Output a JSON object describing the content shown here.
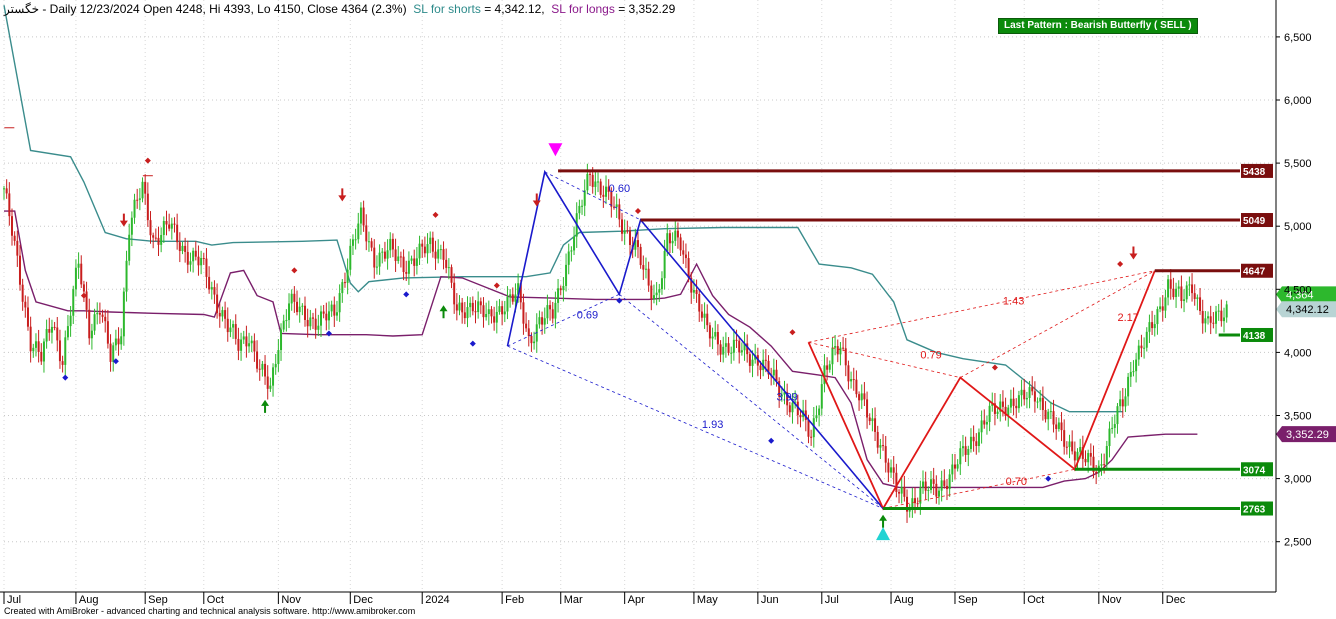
{
  "header": {
    "symbol": "خگستر",
    "info": " - Daily 12/23/2024 Open 4248, Hi 4393, Lo 4150, Close 4364 (2.3%)",
    "sl_shorts_label": "SL for shorts",
    "sl_shorts_value": "= 4,342.12,",
    "sl_longs_label": "SL for longs",
    "sl_longs_value": "= 3,352.29"
  },
  "pattern_badge": "Last Pattern : Bearish Butterfly ( SELL )",
  "credit": "Created with AmiBroker - advanced charting and technical analysis software. http://www.amibroker.com",
  "colors": {
    "background": "#ffffff",
    "up_candle": "#2db82d",
    "down_candle": "#c81e1e",
    "trail_shorts": "#3a8c8c",
    "trail_longs": "#7a1f6b",
    "red_pattern": "#e01818",
    "blue_pattern": "#1a1acc",
    "support": "#0b8a0b",
    "resistance": "#7a0e0e"
  },
  "chart_data": {
    "type": "candlestick",
    "y_axis_ticks": [
      "6,500",
      "6,000",
      "5,500",
      "5,000",
      "4,500",
      "4,000",
      "3,500",
      "3,000",
      "2,500"
    ],
    "y_axis_values": [
      6500,
      6000,
      5500,
      5000,
      4500,
      4000,
      3500,
      3000,
      2500
    ],
    "ylim": [
      2200,
      6900
    ],
    "x_axis_labels": [
      {
        "label": "Jul",
        "x": 0
      },
      {
        "label": "Aug",
        "x": 27
      },
      {
        "label": "Sep",
        "x": 53
      },
      {
        "label": "Oct",
        "x": 75
      },
      {
        "label": "Nov",
        "x": 103
      },
      {
        "label": "Dec",
        "x": 130
      },
      {
        "label": "2024",
        "x": 157
      },
      {
        "label": "Feb",
        "x": 187
      },
      {
        "label": "Mar",
        "x": 209
      },
      {
        "label": "Apr",
        "x": 233
      },
      {
        "label": "May",
        "x": 259
      },
      {
        "label": "Jun",
        "x": 283
      },
      {
        "label": "Jul",
        "x": 307
      },
      {
        "label": "Aug",
        "x": 333
      },
      {
        "label": "Sep",
        "x": 357
      },
      {
        "label": "Oct",
        "x": 383
      },
      {
        "label": "Nov",
        "x": 411
      },
      {
        "label": "Dec",
        "x": 435
      }
    ],
    "xlim": [
      0,
      464
    ],
    "price_path": [
      [
        0,
        5300
      ],
      [
        5,
        4700
      ],
      [
        10,
        4100
      ],
      [
        14,
        3950
      ],
      [
        18,
        4250
      ],
      [
        22,
        3950
      ],
      [
        28,
        4700
      ],
      [
        32,
        4200
      ],
      [
        36,
        4350
      ],
      [
        40,
        3950
      ],
      [
        44,
        4200
      ],
      [
        47,
        5000
      ],
      [
        52,
        5300
      ],
      [
        56,
        4900
      ],
      [
        62,
        5000
      ],
      [
        68,
        4800
      ],
      [
        74,
        4700
      ],
      [
        79,
        4450
      ],
      [
        84,
        4200
      ],
      [
        88,
        4050
      ],
      [
        92,
        4150
      ],
      [
        96,
        3850
      ],
      [
        100,
        3700
      ],
      [
        103,
        4100
      ],
      [
        107,
        4400
      ],
      [
        112,
        4300
      ],
      [
        118,
        4250
      ],
      [
        124,
        4300
      ],
      [
        130,
        4800
      ],
      [
        134,
        5050
      ],
      [
        139,
        4750
      ],
      [
        145,
        4800
      ],
      [
        150,
        4700
      ],
      [
        155,
        4750
      ],
      [
        160,
        4850
      ],
      [
        165,
        4800
      ],
      [
        170,
        4300
      ],
      [
        176,
        4400
      ],
      [
        182,
        4250
      ],
      [
        188,
        4400
      ],
      [
        193,
        4450
      ],
      [
        197,
        4100
      ],
      [
        201,
        4250
      ],
      [
        206,
        4300
      ],
      [
        211,
        4700
      ],
      [
        216,
        5100
      ],
      [
        220,
        5430
      ],
      [
        226,
        5250
      ],
      [
        231,
        5050
      ],
      [
        237,
        4850
      ],
      [
        242,
        4500
      ],
      [
        245,
        4450
      ],
      [
        249,
        4900
      ],
      [
        254,
        4850
      ],
      [
        259,
        4500
      ],
      [
        264,
        4150
      ],
      [
        271,
        4050
      ],
      [
        278,
        4000
      ],
      [
        283,
        3950
      ],
      [
        290,
        3750
      ],
      [
        297,
        3550
      ],
      [
        303,
        3350
      ],
      [
        308,
        3850
      ],
      [
        314,
        4050
      ],
      [
        319,
        3750
      ],
      [
        324,
        3500
      ],
      [
        329,
        3300
      ],
      [
        335,
        2900
      ],
      [
        340,
        2800
      ],
      [
        344,
        2900
      ],
      [
        350,
        2920
      ],
      [
        356,
        3050
      ],
      [
        363,
        3300
      ],
      [
        370,
        3500
      ],
      [
        376,
        3600
      ],
      [
        381,
        3600
      ],
      [
        387,
        3700
      ],
      [
        393,
        3450
      ],
      [
        399,
        3300
      ],
      [
        405,
        3150
      ],
      [
        411,
        3080
      ],
      [
        416,
        3400
      ],
      [
        420,
        3600
      ],
      [
        424,
        3950
      ],
      [
        429,
        4100
      ],
      [
        433,
        4300
      ],
      [
        437,
        4550
      ],
      [
        442,
        4400
      ],
      [
        446,
        4550
      ],
      [
        449,
        4350
      ],
      [
        452,
        4200
      ],
      [
        456,
        4280
      ],
      [
        459,
        4364
      ]
    ],
    "trailing_stop_shorts": [
      [
        0,
        6750
      ],
      [
        10,
        5600
      ],
      [
        25,
        5550
      ],
      [
        30,
        5350
      ],
      [
        38,
        4950
      ],
      [
        46,
        4900
      ],
      [
        56,
        4880
      ],
      [
        72,
        4880
      ],
      [
        78,
        4850
      ],
      [
        86,
        4870
      ],
      [
        112,
        4880
      ],
      [
        125,
        4890
      ],
      [
        130,
        4550
      ],
      [
        133,
        4480
      ],
      [
        137,
        4560
      ],
      [
        150,
        4590
      ],
      [
        172,
        4600
      ],
      [
        196,
        4600
      ],
      [
        205,
        4630
      ],
      [
        210,
        4850
      ],
      [
        216,
        4950
      ],
      [
        232,
        4960
      ],
      [
        248,
        4980
      ],
      [
        270,
        4990
      ],
      [
        298,
        4990
      ],
      [
        306,
        4700
      ],
      [
        318,
        4670
      ],
      [
        326,
        4620
      ],
      [
        334,
        4400
      ],
      [
        339,
        4100
      ],
      [
        350,
        4000
      ],
      [
        360,
        3950
      ],
      [
        376,
        3900
      ],
      [
        386,
        3730
      ],
      [
        393,
        3600
      ],
      [
        400,
        3530
      ],
      [
        420,
        3530
      ]
    ],
    "trailing_stop_longs": [
      [
        0,
        5120
      ],
      [
        4,
        5120
      ],
      [
        8,
        4650
      ],
      [
        12,
        4400
      ],
      [
        24,
        4330
      ],
      [
        30,
        4330
      ],
      [
        40,
        4320
      ],
      [
        56,
        4310
      ],
      [
        75,
        4300
      ],
      [
        79,
        4280
      ],
      [
        85,
        4630
      ],
      [
        90,
        4650
      ],
      [
        95,
        4450
      ],
      [
        101,
        4400
      ],
      [
        104,
        4150
      ],
      [
        118,
        4140
      ],
      [
        136,
        4140
      ],
      [
        146,
        4130
      ],
      [
        157,
        4140
      ],
      [
        164,
        4600
      ],
      [
        172,
        4590
      ],
      [
        190,
        4440
      ],
      [
        206,
        4430
      ],
      [
        222,
        4420
      ],
      [
        242,
        4420
      ],
      [
        248,
        4430
      ],
      [
        254,
        4460
      ],
      [
        260,
        4700
      ],
      [
        266,
        4450
      ],
      [
        272,
        4300
      ],
      [
        280,
        4200
      ],
      [
        288,
        4050
      ],
      [
        296,
        3850
      ],
      [
        306,
        3820
      ],
      [
        312,
        3800
      ],
      [
        318,
        3600
      ],
      [
        324,
        3150
      ],
      [
        330,
        2960
      ],
      [
        336,
        2930
      ],
      [
        360,
        2930
      ],
      [
        390,
        2930
      ],
      [
        398,
        2980
      ],
      [
        406,
        3000
      ],
      [
        411,
        3050
      ],
      [
        416,
        3150
      ],
      [
        422,
        3330
      ],
      [
        436,
        3352
      ],
      [
        448,
        3352
      ]
    ],
    "blue_pattern": [
      [
        189,
        4050
      ],
      [
        203,
        5430
      ],
      [
        231,
        4460
      ],
      [
        239,
        5050
      ],
      [
        330,
        2763
      ]
    ],
    "red_pattern": [
      [
        302,
        4080
      ],
      [
        330,
        2763
      ],
      [
        359,
        3800
      ],
      [
        402,
        3074
      ],
      [
        432,
        4647
      ]
    ],
    "blue_dashed": [
      [
        [
          189,
          4050
        ],
        [
          231,
          4460
        ]
      ],
      [
        [
          203,
          5430
        ],
        [
          239,
          5050
        ]
      ],
      [
        [
          189,
          4050
        ],
        [
          330,
          2763
        ]
      ],
      [
        [
          231,
          4460
        ],
        [
          330,
          2763
        ]
      ]
    ],
    "red_dashed": [
      [
        [
          302,
          4080
        ],
        [
          359,
          3800
        ]
      ],
      [
        [
          330,
          2763
        ],
        [
          402,
          3074
        ]
      ],
      [
        [
          302,
          4080
        ],
        [
          432,
          4647
        ]
      ],
      [
        [
          359,
          3800
        ],
        [
          432,
          4647
        ]
      ]
    ],
    "ratio_labels": [
      {
        "text": "0.60",
        "x": 227,
        "y": 5270,
        "color": "blue"
      },
      {
        "text": "0.69",
        "x": 215,
        "y": 4270,
        "color": "blue"
      },
      {
        "text": "3.99",
        "x": 290,
        "y": 3620,
        "color": "blue"
      },
      {
        "text": "1.93",
        "x": 262,
        "y": 3400,
        "color": "blue"
      },
      {
        "text": "1.43",
        "x": 375,
        "y": 4380,
        "color": "red"
      },
      {
        "text": "0.79",
        "x": 344,
        "y": 3950,
        "color": "red"
      },
      {
        "text": "2.17",
        "x": 418,
        "y": 4250,
        "color": "red"
      },
      {
        "text": "0.70",
        "x": 376,
        "y": 2950,
        "color": "red"
      }
    ],
    "horizontal_levels": [
      {
        "value": 5438,
        "label": "5438",
        "from": 208,
        "color": "resistance"
      },
      {
        "value": 5049,
        "label": "5049",
        "from": 239,
        "color": "resistance"
      },
      {
        "value": 4647,
        "label": "4647",
        "from": 432,
        "color": "resistance"
      },
      {
        "value": 3074,
        "label": "3074",
        "from": 402,
        "color": "support"
      },
      {
        "value": 2763,
        "label": "2763",
        "from": 330,
        "color": "support"
      },
      {
        "value": 4138,
        "label": "4138",
        "from": 456,
        "color": "support"
      }
    ],
    "last_close_badge": "4,364",
    "sl_shorts_badge": "4,342.12",
    "sl_longs_badge": "3,352.29"
  }
}
